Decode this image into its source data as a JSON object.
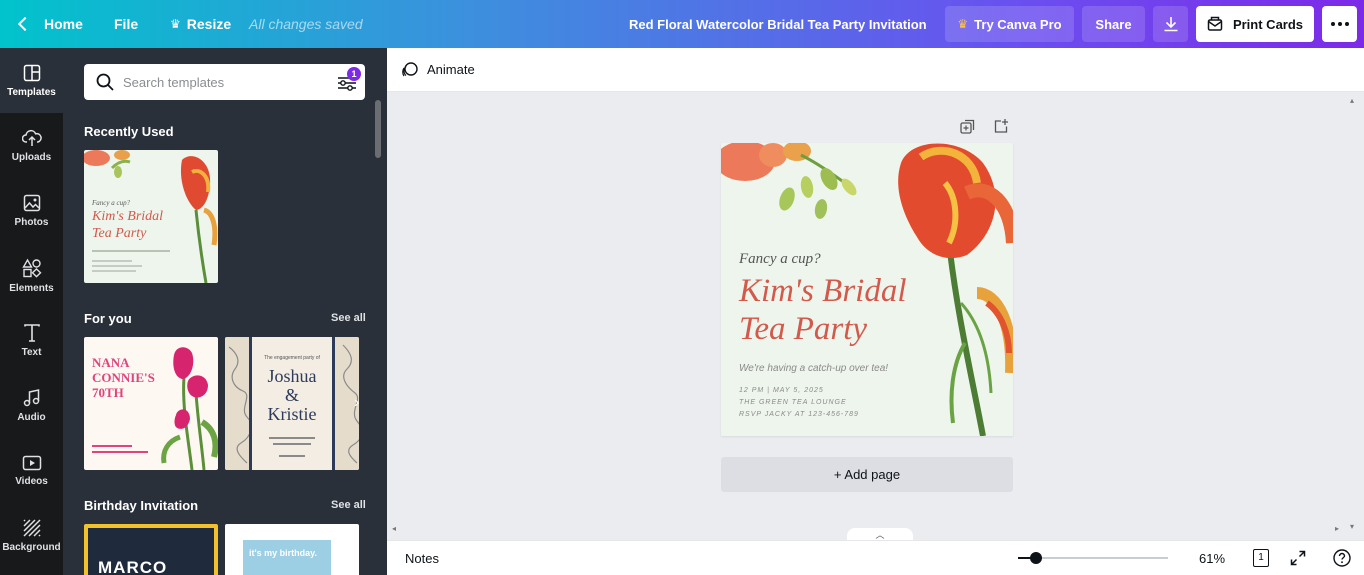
{
  "topbar": {
    "home_label": "Home",
    "file_label": "File",
    "resize_label": "Resize",
    "saved_status": "All changes saved",
    "doc_title": "Red Floral Watercolor Bridal Tea Party Invitation",
    "try_pro_label": "Try Canva Pro",
    "share_label": "Share",
    "print_label": "Print Cards",
    "icons": [
      "chevron-left-icon",
      "crown-icon",
      "download-icon",
      "print-icon",
      "more-icon"
    ]
  },
  "rail": {
    "items": [
      {
        "label": "Templates",
        "icon": "templates-icon",
        "active": true
      },
      {
        "label": "Uploads",
        "icon": "upload-icon"
      },
      {
        "label": "Photos",
        "icon": "photo-icon"
      },
      {
        "label": "Elements",
        "icon": "elements-icon"
      },
      {
        "label": "Text",
        "icon": "text-icon"
      },
      {
        "label": "Audio",
        "icon": "audio-icon"
      },
      {
        "label": "Videos",
        "icon": "video-icon"
      },
      {
        "label": "Background",
        "icon": "background-icon"
      }
    ]
  },
  "panel": {
    "search_placeholder": "Search templates",
    "filter_badge": "1",
    "recently_used_title": "Recently Used",
    "recent_thumb": {
      "line1": "Fancy a cup?",
      "line2": "Kim's Bridal",
      "line3": "Tea Party"
    },
    "for_you_title": "For you",
    "see_all": "See all",
    "for_you_thumbs": [
      {
        "lines": [
          "NANA",
          "CONNIE'S",
          "70TH"
        ]
      },
      {
        "intro": "The engagement party of",
        "name1": "Joshua",
        "amp": "&",
        "name2": "Kristie"
      }
    ],
    "birthday_title": "Birthday Invitation",
    "birthday_thumbs": [
      {
        "text": "MARCO TURNS"
      },
      {
        "text": "it's my birthday."
      }
    ]
  },
  "editor": {
    "animate_label": "Animate",
    "add_page_label": "+ Add page",
    "notes_label": "Notes",
    "zoom_label": "61%",
    "page_count": "1",
    "zoom_level_percent": 61
  },
  "card": {
    "line1": "Fancy a cup?",
    "title1": "Kim's Bridal",
    "title2": "Tea Party",
    "subtitle": "We're having a catch-up over tea!",
    "detail1": "12 PM | MAY 5, 2025",
    "detail2": "THE GREEN TEA LOUNGE",
    "detail3": "RSVP JACKY AT 123-456-789"
  },
  "colors": {
    "accent": "#7d2ae8",
    "teal": "#01c3cc",
    "rail_bg": "#18191b",
    "panel_bg": "#293039",
    "title_red": "#d25a4c"
  }
}
